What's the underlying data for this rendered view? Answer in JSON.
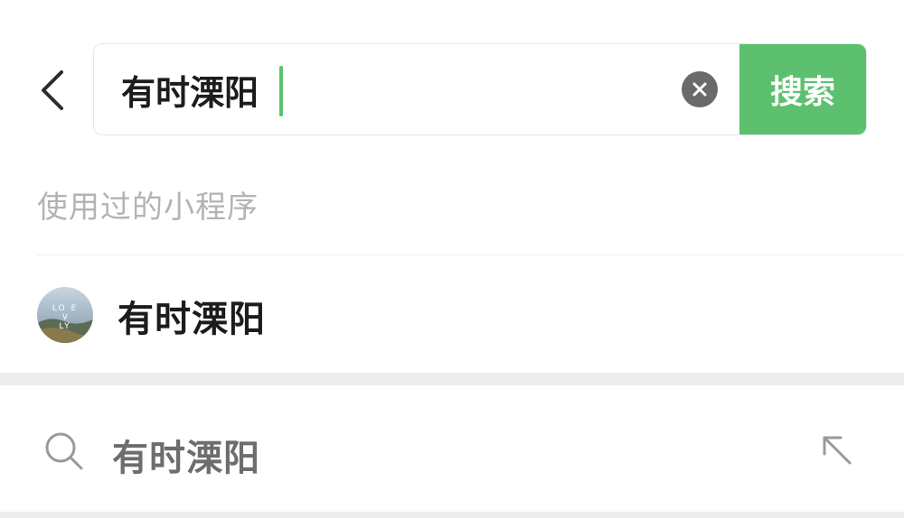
{
  "search": {
    "value": "有时溧阳",
    "button_label": "搜索"
  },
  "section": {
    "title": "使用过的小程序"
  },
  "mini_programs": [
    {
      "name": "有时溧阳",
      "avatar_icon": "lovely-landscape-avatar",
      "avatar_text": "LOVELY"
    }
  ],
  "suggestions": [
    {
      "text": "有时溧阳",
      "icon": "search-icon",
      "action_icon": "fill-arrow-icon"
    }
  ],
  "colors": {
    "accent": "#5cc06e",
    "text_primary": "#1c1c1c",
    "text_muted": "#b3b3b3"
  }
}
